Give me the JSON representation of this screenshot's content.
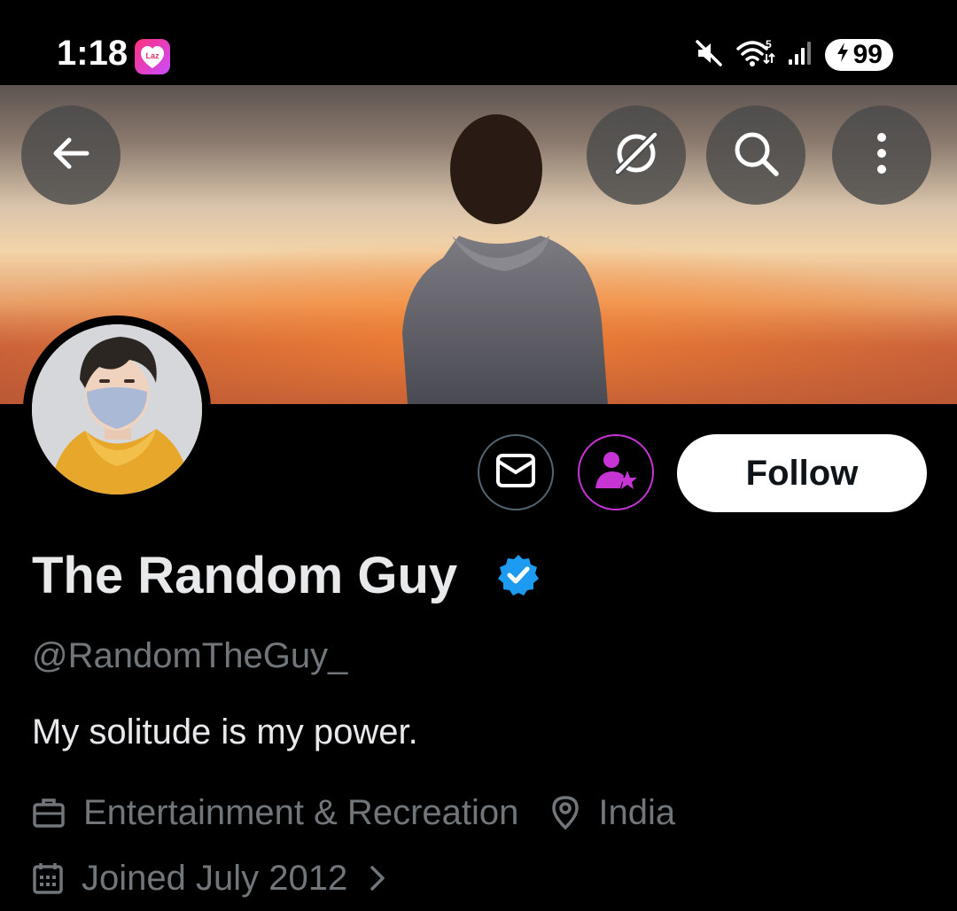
{
  "status_bar": {
    "time": "1:18",
    "app_badge": "Laz",
    "network_label": "5",
    "battery": "99",
    "icons": [
      "mute-icon",
      "wifi-icon",
      "signal-icon",
      "charging-icon"
    ]
  },
  "header": {
    "icons": [
      "back-arrow-icon",
      "grok-icon",
      "search-icon",
      "more-vertical-icon"
    ]
  },
  "profile": {
    "display_name": "The Random Guy",
    "verified": true,
    "handle": "@RandomTheGuy_",
    "bio": "My solitude is my power.",
    "category": "Entertainment & Recreation",
    "location": "India",
    "joined": "Joined July 2012"
  },
  "actions": {
    "follow_label": "Follow",
    "icons": [
      "message-icon",
      "subscribe-icon"
    ]
  },
  "colors": {
    "background": "#000000",
    "primary_text": "#e7e9ea",
    "secondary_text": "#71767b",
    "verified_blue": "#1d9bf0",
    "subscribe_purple": "#c634d4"
  }
}
